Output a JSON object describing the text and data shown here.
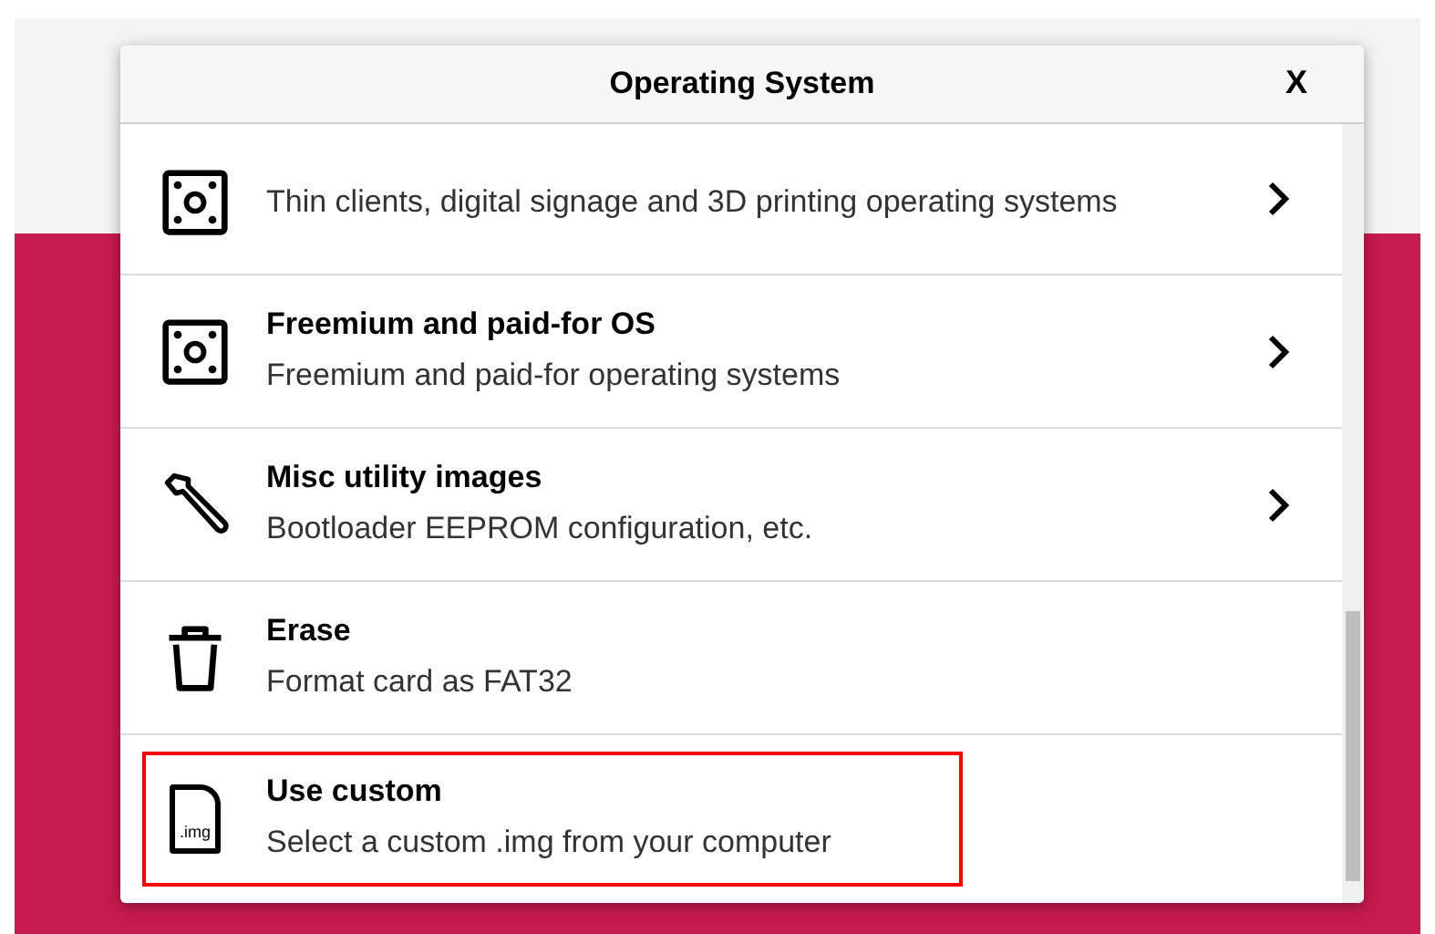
{
  "dialog": {
    "title": "Operating System",
    "close": "X"
  },
  "items": [
    {
      "kind": "board",
      "description": "Thin clients, digital signage and 3D printing operating systems",
      "has_submenu": true,
      "highlighted": false
    },
    {
      "kind": "board",
      "title": "Freemium and paid-for OS",
      "description": "Freemium and paid-for operating systems",
      "has_submenu": true,
      "highlighted": false
    },
    {
      "kind": "wrench",
      "title": "Misc utility images",
      "description": "Bootloader EEPROM configuration, etc.",
      "has_submenu": true,
      "highlighted": false
    },
    {
      "kind": "trash",
      "title": "Erase",
      "description": "Format card as FAT32",
      "has_submenu": false,
      "highlighted": false
    },
    {
      "kind": "file",
      "title": "Use custom",
      "description": "Select a custom .img from your computer",
      "has_submenu": false,
      "highlighted": true,
      "icon_label": ".img"
    }
  ]
}
